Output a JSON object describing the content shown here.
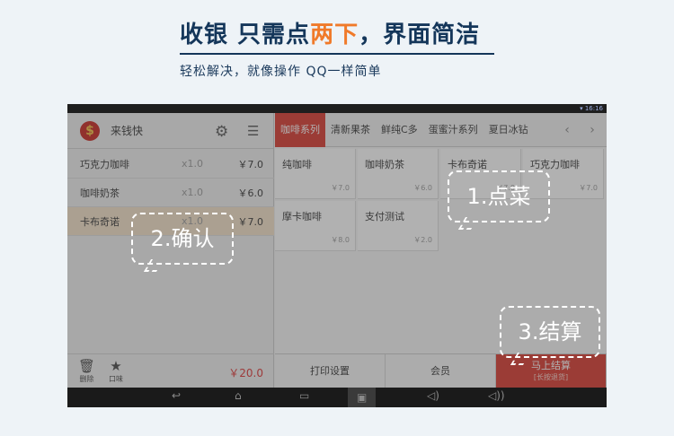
{
  "headline": {
    "title_part1": "收银 只需点",
    "title_accent": "两下",
    "title_part2": "，界面简洁",
    "subtitle": "轻松解决，就像操作 QQ一样简单"
  },
  "status_bar": {
    "time": "16:16"
  },
  "app": {
    "logo_glyph": "$",
    "name": "来钱快",
    "settings_icon": "gear-icon",
    "menu_icon": "list-icon"
  },
  "orders": [
    {
      "name": "巧克力咖啡",
      "qty": "x1.0",
      "price": "￥7.0"
    },
    {
      "name": "咖啡奶茶",
      "qty": "x1.0",
      "price": "￥6.0"
    },
    {
      "name": "卡布奇诺",
      "qty": "x1.0",
      "price": "￥7.0"
    }
  ],
  "order_tools": {
    "delete_label": "删除",
    "flavor_label": "口味",
    "total": "￥20.0"
  },
  "tabs": [
    "咖啡系列",
    "清新果茶",
    "鲜纯C多",
    "蛋蜜汁系列",
    "夏日冰钻"
  ],
  "products": [
    {
      "name": "纯咖啡",
      "price": "￥7.0"
    },
    {
      "name": "咖啡奶茶",
      "price": "￥6.0"
    },
    {
      "name": "卡布奇诺",
      "price": "￥7.0"
    },
    {
      "name": "巧克力咖啡",
      "price": "￥7.0"
    },
    {
      "name": "摩卡咖啡",
      "price": "￥8.0"
    },
    {
      "name": "支付测试",
      "price": "￥2.0"
    }
  ],
  "actions": {
    "print_settings": "打印设置",
    "member": "会员",
    "checkout": "马上结算",
    "checkout_hint": "[长按退货]"
  },
  "callouts": {
    "step1": "1.点菜",
    "step2": "2.确认",
    "step3": "3.结算"
  },
  "colors": {
    "accent_red": "#d9362c",
    "headline_navy": "#14365a",
    "headline_orange": "#f07a2a"
  }
}
